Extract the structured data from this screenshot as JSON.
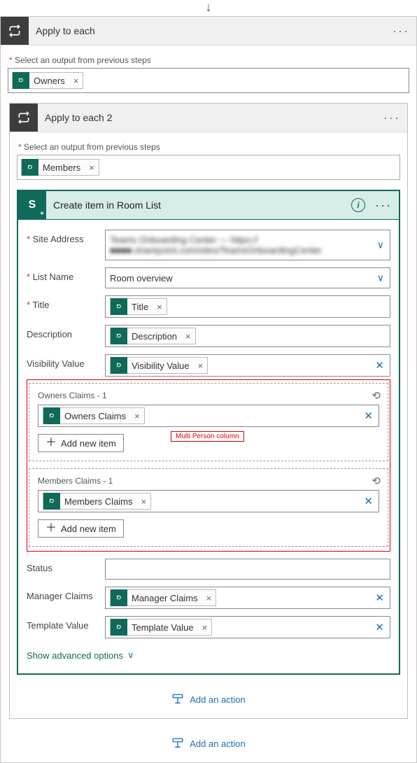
{
  "arrow": "↓",
  "outer": {
    "title": "Apply to each",
    "select_label": "Select an output from previous steps",
    "chip": {
      "label": "Owners",
      "icon": "sp"
    },
    "add_action": "Add an action"
  },
  "inner": {
    "title": "Apply to each 2",
    "select_label": "Select an output from previous steps",
    "chip": {
      "label": "Members",
      "icon": "sp"
    },
    "add_action": "Add an action"
  },
  "action": {
    "title": "Create item in Room List",
    "fields": {
      "site_address": {
        "label": "Site Address",
        "value_blurred": "Teams Onboarding Center — https://■■■■.sharepoint.com/sites/TeamsOnboardingCenter"
      },
      "list_name": {
        "label": "List Name",
        "value": "Room overview"
      },
      "title": {
        "label": "Title",
        "chip": "Title"
      },
      "description": {
        "label": "Description",
        "chip": "Description"
      },
      "visibility": {
        "label": "Visibility Value",
        "chip": "Visibility Value"
      },
      "owners": {
        "label": "Owners Claims - 1",
        "chip": "Owners Claims",
        "add": "Add new item"
      },
      "members": {
        "label": "Members Claims - 1",
        "chip": "Members Claims",
        "add": "Add new item"
      },
      "status": {
        "label": "Status"
      },
      "manager": {
        "label": "Manager Claims",
        "chip": "Manager Claims"
      },
      "template": {
        "label": "Template Value",
        "chip": "Template Value"
      }
    },
    "advanced": "Show advanced options"
  },
  "annotation": "Multi Person column"
}
